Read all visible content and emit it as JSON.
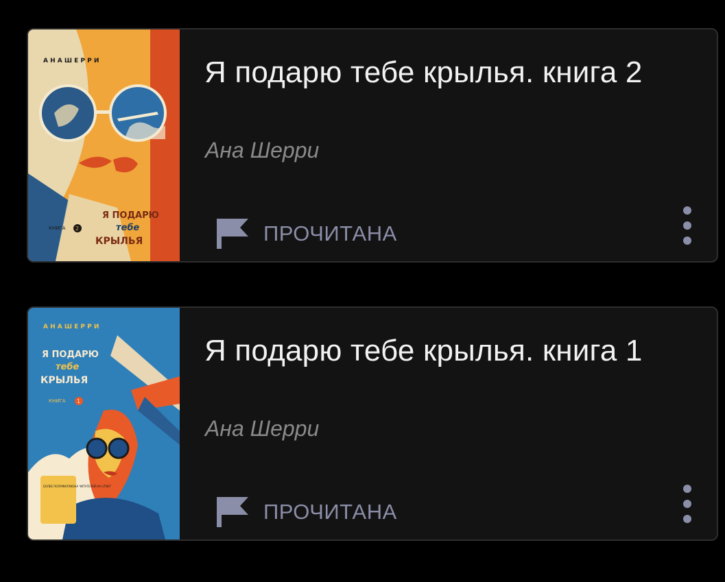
{
  "books": [
    {
      "title": "Я подарю тебе крылья. книга 2",
      "author": "Ана Шерри",
      "status": "ПРОЧИТАНА",
      "cover": {
        "author_caption": "А Н А   Ш Е Р Р И",
        "line1": "Я ПОДАРЮ",
        "line2": "тебе",
        "line3": "КРЫЛЬЯ",
        "book_label": "КНИГА",
        "book_number": "2",
        "colors": [
          "#f0a63a",
          "#d94d22",
          "#e9d8ae",
          "#2b5a88"
        ]
      }
    },
    {
      "title": "Я подарю тебе крылья. книга 1",
      "author": "Ана Шерри",
      "status": "ПРОЧИТАНА",
      "cover": {
        "author_caption": "А Н А   Ш Е Р Р И",
        "line1": "Я ПОДАРЮ",
        "line2": "тебе",
        "line3": "КРЫЛЬЯ",
        "book_label": "КНИГА",
        "book_number": "1",
        "badge": "БОЛЕЕ ПОЛУМИЛЛИОНА ЧИТАТЕЛЕЙ НА LITNET",
        "colors": [
          "#2f7fb8",
          "#e85a28",
          "#f2c24a",
          "#f6ead0"
        ]
      }
    }
  ],
  "icons": {
    "status": "flag-icon",
    "menu": "more-vertical-icon"
  },
  "colors": {
    "background": "#000000",
    "card": "#131313",
    "title": "#f2f2f2",
    "author": "#8a8a8a",
    "accent": "#8b8ea8"
  }
}
